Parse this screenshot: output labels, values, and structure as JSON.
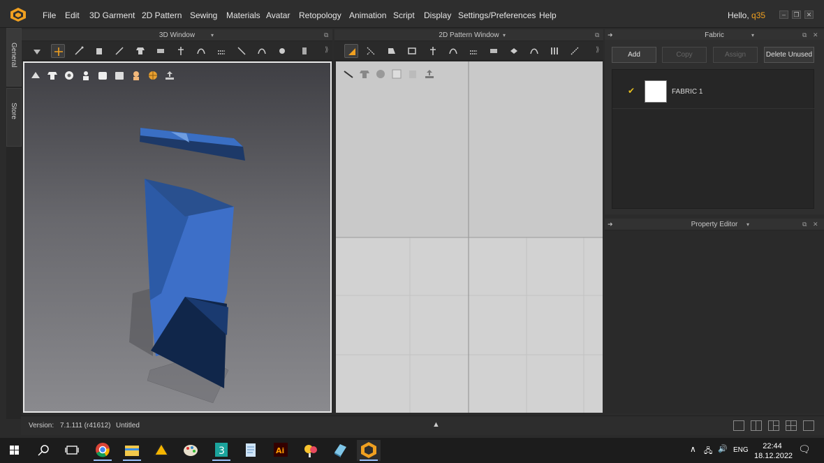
{
  "app": {
    "menus": [
      "File",
      "Edit",
      "3D Garment",
      "2D Pattern",
      "Sewing",
      "Materials",
      "Avatar",
      "Retopology",
      "Animation",
      "Script",
      "Display",
      "Settings/Preferences",
      "Help"
    ],
    "greeting": "Hello,",
    "user": "q35"
  },
  "sidetabs": {
    "general": "General",
    "store": "Store"
  },
  "windows": {
    "view3d_title": "3D Window",
    "view2d_title": "2D Pattern Window",
    "fabric_title": "Fabric",
    "property_title": "Property Editor"
  },
  "fabric": {
    "buttons": {
      "add": "Add",
      "copy": "Copy",
      "assign": "Assign",
      "delete_unused": "Delete Unused"
    },
    "items": [
      {
        "name": "FABRIC 1",
        "checked": "✔",
        "swatch_color": "#ffffff"
      }
    ]
  },
  "status": {
    "version_label": "Version:",
    "version_value": "7.1.111 (r41612)",
    "file": "Untitled"
  },
  "taskbar": {
    "apps": [
      "windows-start",
      "search",
      "task-view",
      "chrome",
      "file-explorer",
      "drive",
      "paint",
      "3ds-app",
      "notepad",
      "illustrator",
      "paint-3d",
      "generic-app",
      "clo3d"
    ],
    "lang": "ENG",
    "time": "22:44",
    "date": "18.12.2022"
  },
  "colors": {
    "accent": "#f0a020",
    "garment": "#3d72c6",
    "check": "#e8c020"
  }
}
